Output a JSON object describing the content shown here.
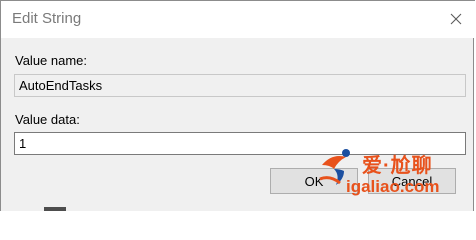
{
  "window": {
    "title": "Edit String",
    "close_icon": "close-icon"
  },
  "form": {
    "value_name_label": "Value name:",
    "value_name": "AutoEndTasks",
    "value_data_label": "Value data:",
    "value_data": "1"
  },
  "buttons": {
    "ok_label": "OK",
    "cancel_label": "Cancel"
  },
  "watermark": {
    "text": "爱·尬聊",
    "url": "igaliao.com",
    "color": "#e8521c"
  },
  "colors": {
    "client_bg": "#f0f0f0",
    "titlebar_bg": "#ffffff",
    "title_text": "#7a7a7a"
  }
}
